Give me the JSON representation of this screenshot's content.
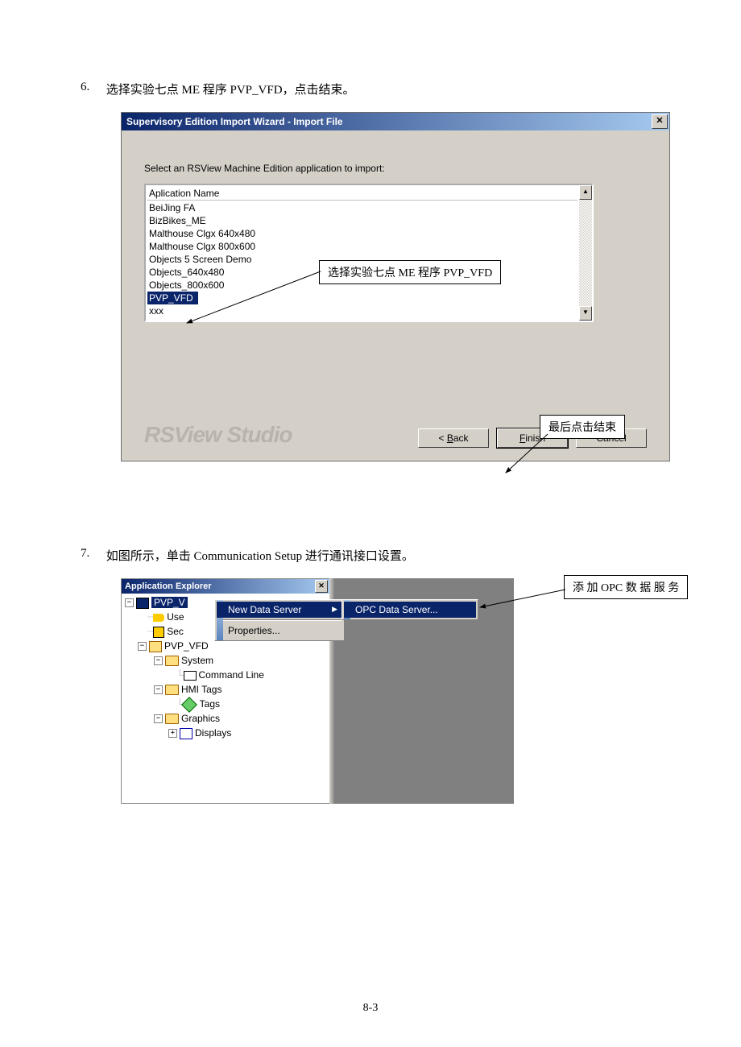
{
  "step6": {
    "num": "6.",
    "text": "选择实验七点 ME 程序 PVP_VFD，点击结束。"
  },
  "dialog1": {
    "title": "Supervisory Edition Import Wizard - Import File",
    "label": "Select an RSView Machine Edition application to import:",
    "column": "Aplication Name",
    "items": [
      "BeiJing FA",
      "BizBikes_ME",
      "Malthouse Clgx 640x480",
      "Malthouse Clgx 800x600",
      "Objects 5 Screen Demo",
      "Objects_640x480",
      "Objects_800x600",
      "PVP_VFD",
      "xxx"
    ],
    "selected": "PVP_VFD",
    "brand": "RSView Studio",
    "btn_back": "Back",
    "btn_finish": "Finish",
    "btn_cancel": "Cancel"
  },
  "callout1": "选择实验七点 ME 程序 PVP_VFD",
  "callout2": "最后点击结束",
  "step7": {
    "num": "7.",
    "text": "如图所示，单击 Communication Setup 进行通讯接口设置。"
  },
  "explorer": {
    "title": "Application Explorer",
    "root": "PVP_V",
    "users": "Use",
    "security": "Sec",
    "app": "PVP_VFD",
    "system": "System",
    "cmdline": "Command Line",
    "hmitags": "HMI Tags",
    "tags": "Tags",
    "graphics": "Graphics",
    "displays": "Displays"
  },
  "menu": {
    "newdata": "New Data Server",
    "properties": "Properties...",
    "opc": "OPC Data Server..."
  },
  "callout3": "添 加 OPC 数 据 服 务",
  "page_num": "8-3"
}
